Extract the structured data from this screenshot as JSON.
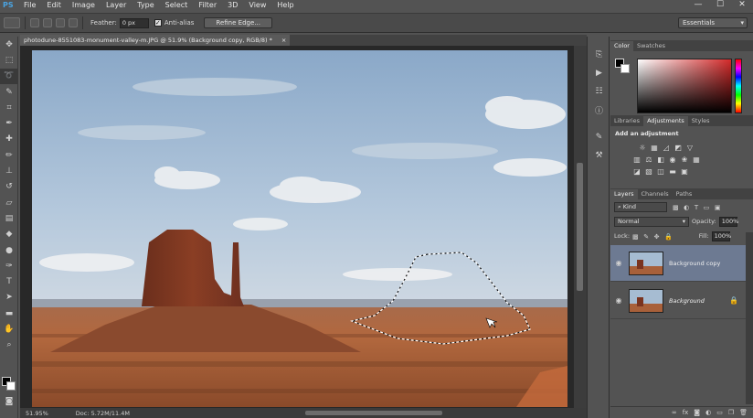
{
  "app": {
    "logo": "PS"
  },
  "menu": [
    "File",
    "Edit",
    "Image",
    "Layer",
    "Type",
    "Select",
    "Filter",
    "3D",
    "View",
    "Help"
  ],
  "window_controls": {
    "minimize": "—",
    "restore": "☐",
    "close": "✕"
  },
  "options_bar": {
    "feather_label": "Feather:",
    "feather_value": "0 px",
    "antialias_label": "Anti-alias",
    "antialias_checked": true,
    "refine_edge_label": "Refine Edge...",
    "workspace_value": "Essentials"
  },
  "document": {
    "tab_title": "photodune-8551083-monument-valley-m.JPG @ 51.9% (Background copy, RGB/8) *",
    "tab_close": "×"
  },
  "status_bar": {
    "zoom": "51.95%",
    "doc_info": "Doc: 5.72M/11.4M"
  },
  "color_panel": {
    "tabs": [
      "Color",
      "Swatches"
    ],
    "active_tab": "Color",
    "foreground": "#000000",
    "background": "#ffffff",
    "hue_color": "#d42a2a"
  },
  "adjustments_panel": {
    "tabs": [
      "Libraries",
      "Adjustments",
      "Styles"
    ],
    "active_tab": "Adjustments",
    "title": "Add an adjustment"
  },
  "layers_panel": {
    "tabs": [
      "Layers",
      "Channels",
      "Paths"
    ],
    "active_tab": "Layers",
    "filter_kind": "Kind",
    "blend_mode": "Normal",
    "opacity_label": "Opacity:",
    "opacity_value": "100%",
    "lock_label": "Lock:",
    "fill_label": "Fill:",
    "fill_value": "100%",
    "layers": [
      {
        "name": "Background copy",
        "selected": true,
        "visible": true,
        "locked": false
      },
      {
        "name": "Background",
        "selected": false,
        "visible": true,
        "locked": true
      }
    ]
  },
  "colors": {
    "ui_bg": "#535353",
    "ui_dark": "#3b3b3b",
    "selection_highlight": "#6d7a92",
    "logo_blue": "#4aa3e0"
  }
}
